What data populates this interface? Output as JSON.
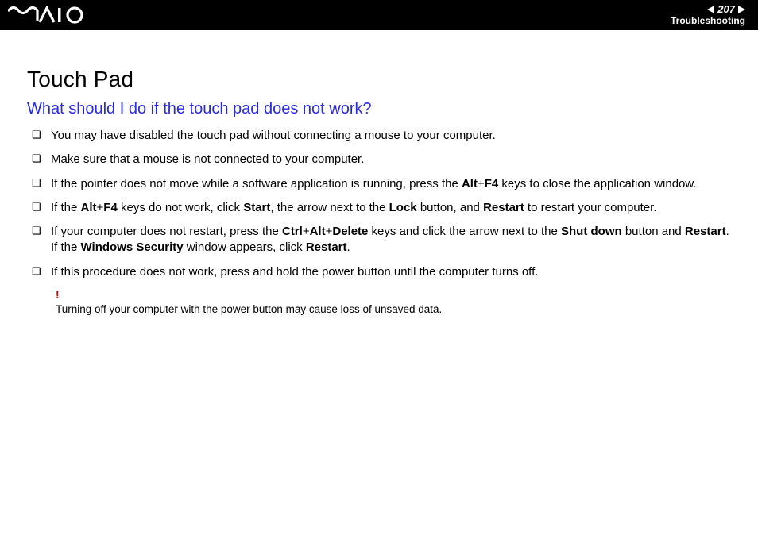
{
  "header": {
    "page_number": "207",
    "section": "Troubleshooting"
  },
  "content": {
    "title": "Touch Pad",
    "subtitle": "What should I do if the touch pad does not work?",
    "bullets": {
      "b1": "You may have disabled the touch pad without connecting a mouse to your computer.",
      "b2": "Make sure that a mouse is not connected to your computer.",
      "b3": {
        "t1": "If the pointer does not move while a software application is running, press the ",
        "k1": "Alt",
        "plus1": "+",
        "k2": "F4",
        "t2": " keys to close the application window."
      },
      "b4": {
        "t1": "If the ",
        "k1": "Alt",
        "plus1": "+",
        "k2": "F4",
        "t2": " keys do not work, click ",
        "k3": "Start",
        "t3": ", the arrow next to the ",
        "k4": "Lock",
        "t4": " button, and ",
        "k5": "Restart",
        "t5": " to restart your computer."
      },
      "b5": {
        "t1": "If your computer does not restart, press the ",
        "k1": "Ctrl",
        "plus1": "+",
        "k2": "Alt",
        "plus2": "+",
        "k3": "Delete",
        "t2": " keys and click the arrow next to the ",
        "k4": "Shut down",
        "t3": " button and ",
        "k5": "Restart",
        "t4": ".",
        "line2a": "If the ",
        "k6": "Windows Security",
        "line2b": " window appears, click ",
        "k7": "Restart",
        "line2c": "."
      },
      "b6": "If this procedure does not work, press and hold the power button until the computer turns off."
    },
    "note": {
      "bang": "!",
      "text": "Turning off your computer with the power button may cause loss of unsaved data."
    }
  }
}
